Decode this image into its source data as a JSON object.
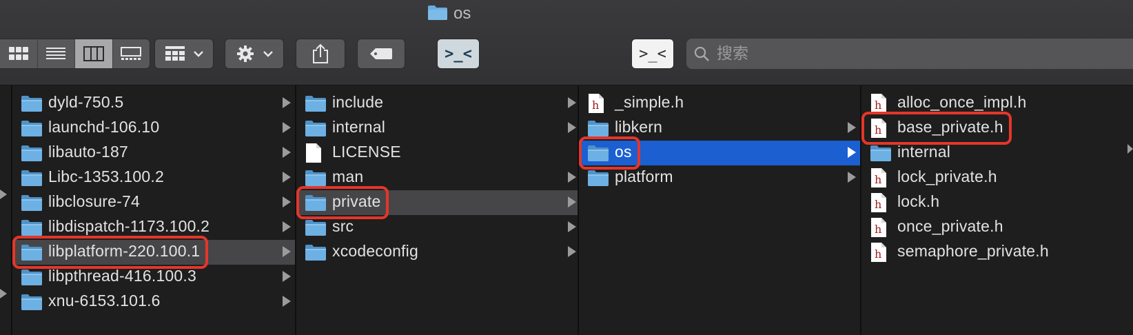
{
  "window": {
    "title": "os",
    "title_icon": "folder-icon"
  },
  "toolbar": {
    "view_buttons": [
      "icon-view",
      "list-view",
      "column-view",
      "gallery-view"
    ],
    "selected_view": "column-view",
    "group_icon": "group-grid-icon",
    "action_icon": "gear-icon",
    "share_icon": "share-icon",
    "tag_icon": "tag-icon",
    "terminal_icon_text": ">_<",
    "terminal2_icon_text": ">_<",
    "search_placeholder": "搜索"
  },
  "columns": [
    {
      "items": [
        {
          "name": "dyld-750.5",
          "type": "folder",
          "has_children": true
        },
        {
          "name": "launchd-106.10",
          "type": "folder",
          "has_children": true
        },
        {
          "name": "libauto-187",
          "type": "folder",
          "has_children": true
        },
        {
          "name": "Libc-1353.100.2",
          "type": "folder",
          "has_children": true
        },
        {
          "name": "libclosure-74",
          "type": "folder",
          "has_children": true
        },
        {
          "name": "libdispatch-1173.100.2",
          "type": "folder",
          "has_children": true
        },
        {
          "name": "libplatform-220.100.1",
          "type": "folder",
          "has_children": true,
          "state": "path",
          "marked": true
        },
        {
          "name": "libpthread-416.100.3",
          "type": "folder",
          "has_children": true
        },
        {
          "name": "xnu-6153.101.6",
          "type": "folder",
          "has_children": true
        }
      ]
    },
    {
      "items": [
        {
          "name": "include",
          "type": "folder",
          "has_children": true
        },
        {
          "name": "internal",
          "type": "folder",
          "has_children": true
        },
        {
          "name": "LICENSE",
          "type": "document",
          "has_children": false
        },
        {
          "name": "man",
          "type": "folder",
          "has_children": true
        },
        {
          "name": "private",
          "type": "folder",
          "has_children": true,
          "state": "path",
          "marked": true
        },
        {
          "name": "src",
          "type": "folder",
          "has_children": true
        },
        {
          "name": "xcodeconfig",
          "type": "folder",
          "has_children": true
        }
      ]
    },
    {
      "items": [
        {
          "name": "_simple.h",
          "type": "header",
          "has_children": false
        },
        {
          "name": "libkern",
          "type": "folder",
          "has_children": true
        },
        {
          "name": "os",
          "type": "folder",
          "has_children": true,
          "state": "selected",
          "marked": true
        },
        {
          "name": "platform",
          "type": "folder",
          "has_children": true
        }
      ]
    },
    {
      "items": [
        {
          "name": "alloc_once_impl.h",
          "type": "header",
          "has_children": false
        },
        {
          "name": "base_private.h",
          "type": "header",
          "has_children": false,
          "marked": true
        },
        {
          "name": "internal",
          "type": "folder",
          "has_children": true
        },
        {
          "name": "lock_private.h",
          "type": "header",
          "has_children": false
        },
        {
          "name": "lock.h",
          "type": "header",
          "has_children": false
        },
        {
          "name": "once_private.h",
          "type": "header",
          "has_children": false
        },
        {
          "name": "semaphore_private.h",
          "type": "header",
          "has_children": false
        }
      ]
    }
  ],
  "colors": {
    "selection": "#1b5fd0",
    "path_highlight": "#464648",
    "annotation": "#e6352a",
    "folder": "#5aa5dd"
  }
}
